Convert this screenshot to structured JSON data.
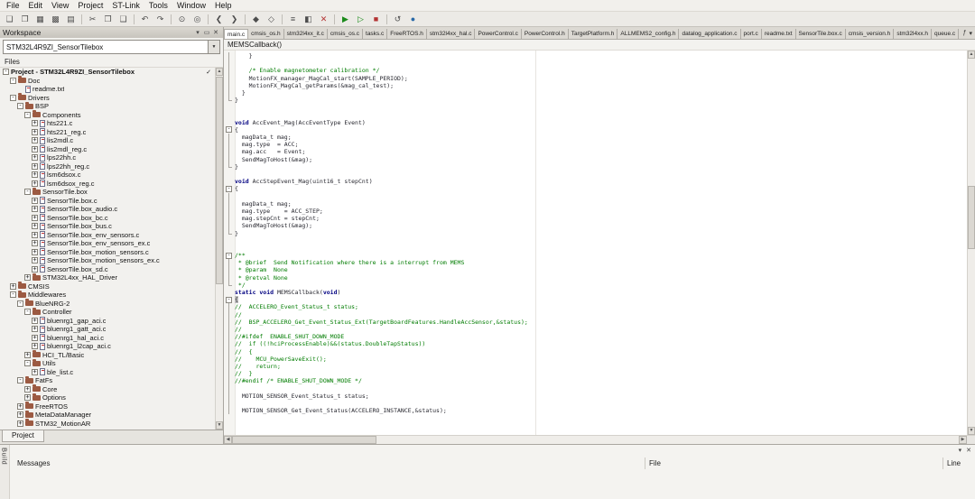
{
  "colors": {
    "comment": "#007c00",
    "keyword": "#000080",
    "plain_code": "#26262e",
    "chrome": "#e8e6e2",
    "editor_background": "#ffffff",
    "group_icon": "#9c5a42"
  },
  "menu": {
    "items": [
      "File",
      "Edit",
      "View",
      "Project",
      "ST-Link",
      "Tools",
      "Window",
      "Help"
    ]
  },
  "toolbar": {
    "buttons": [
      {
        "n": "new-document",
        "g": "❏"
      },
      {
        "n": "open-file",
        "g": "❐"
      },
      {
        "n": "save",
        "g": "▦"
      },
      {
        "n": "save-all",
        "g": "▩"
      },
      {
        "n": "print",
        "g": "▤"
      },
      {
        "sep": true
      },
      {
        "n": "cut",
        "g": "✂"
      },
      {
        "n": "copy",
        "g": "❒"
      },
      {
        "n": "paste",
        "g": "❑"
      },
      {
        "sep": true
      },
      {
        "n": "undo",
        "g": "↶"
      },
      {
        "n": "redo",
        "g": "↷"
      },
      {
        "sep": true
      },
      {
        "n": "find",
        "g": "⊙"
      },
      {
        "n": "find-next",
        "g": "◎"
      },
      {
        "sep": true
      },
      {
        "n": "navigate-back",
        "g": "❮"
      },
      {
        "n": "navigate-forward",
        "g": "❯"
      },
      {
        "sep": true
      },
      {
        "n": "toggle-bookmark",
        "g": "◆"
      },
      {
        "n": "next-bookmark",
        "g": "◇"
      },
      {
        "sep": true
      },
      {
        "n": "make",
        "g": "≡"
      },
      {
        "n": "compile",
        "g": "◧"
      },
      {
        "n": "stop-build",
        "g": "✕",
        "c": "#b33333"
      },
      {
        "sep": true
      },
      {
        "n": "download-and-debug",
        "g": "▶",
        "c": "#1a8a1a"
      },
      {
        "n": "debug-without-downloading",
        "g": "▷",
        "c": "#1a8a1a"
      },
      {
        "n": "stop-debug",
        "g": "■",
        "c": "#b33333"
      },
      {
        "sep": true
      },
      {
        "n": "reset",
        "g": "↺"
      },
      {
        "n": "st-link-utility",
        "g": "●",
        "c": "#2a6aa8"
      }
    ]
  },
  "workspace": {
    "title": "Workspace",
    "config": "STM32L4R9ZI_SensorTilebox",
    "files_header": "Files",
    "bottom_tab": "Project",
    "tree": [
      {
        "d": 0,
        "e": "-",
        "i": "",
        "t": "Project - STM32L4R9ZI_SensorTilebox",
        "bold": true,
        "check": true
      },
      {
        "d": 1,
        "e": "-",
        "i": "folder",
        "t": "Doc"
      },
      {
        "d": 2,
        "e": "",
        "i": "file",
        "t": "readme.txt"
      },
      {
        "d": 1,
        "e": "-",
        "i": "folder",
        "t": "Drivers"
      },
      {
        "d": 2,
        "e": "-",
        "i": "folder",
        "t": "BSP"
      },
      {
        "d": 3,
        "e": "-",
        "i": "folder",
        "t": "Components"
      },
      {
        "d": 4,
        "e": "+",
        "i": "file",
        "t": "hts221.c"
      },
      {
        "d": 4,
        "e": "+",
        "i": "file",
        "t": "hts221_reg.c"
      },
      {
        "d": 4,
        "e": "+",
        "i": "file",
        "t": "lis2mdl.c"
      },
      {
        "d": 4,
        "e": "+",
        "i": "file",
        "t": "lis2mdl_reg.c"
      },
      {
        "d": 4,
        "e": "+",
        "i": "file",
        "t": "lps22hh.c"
      },
      {
        "d": 4,
        "e": "+",
        "i": "file",
        "t": "lps22hh_reg.c"
      },
      {
        "d": 4,
        "e": "+",
        "i": "file",
        "t": "lsm6dsox.c"
      },
      {
        "d": 4,
        "e": "+",
        "i": "file",
        "t": "lsm6dsox_reg.c"
      },
      {
        "d": 3,
        "e": "-",
        "i": "folder",
        "t": "SensorTile.box"
      },
      {
        "d": 4,
        "e": "+",
        "i": "file",
        "t": "SensorTile.box.c"
      },
      {
        "d": 4,
        "e": "+",
        "i": "file",
        "t": "SensorTile.box_audio.c"
      },
      {
        "d": 4,
        "e": "+",
        "i": "file",
        "t": "SensorTile.box_bc.c"
      },
      {
        "d": 4,
        "e": "+",
        "i": "file",
        "t": "SensorTile.box_bus.c"
      },
      {
        "d": 4,
        "e": "+",
        "i": "file",
        "t": "SensorTile.box_env_sensors.c"
      },
      {
        "d": 4,
        "e": "+",
        "i": "file",
        "t": "SensorTile.box_env_sensors_ex.c"
      },
      {
        "d": 4,
        "e": "+",
        "i": "file",
        "t": "SensorTile.box_motion_sensors.c"
      },
      {
        "d": 4,
        "e": "+",
        "i": "file",
        "t": "SensorTile.box_motion_sensors_ex.c"
      },
      {
        "d": 4,
        "e": "+",
        "i": "file",
        "t": "SensorTile.box_sd.c"
      },
      {
        "d": 3,
        "e": "+",
        "i": "folder",
        "t": "STM32L4xx_HAL_Driver"
      },
      {
        "d": 1,
        "e": "+",
        "i": "folder",
        "t": "CMSIS"
      },
      {
        "d": 1,
        "e": "-",
        "i": "folder",
        "t": "Middlewares"
      },
      {
        "d": 2,
        "e": "-",
        "i": "folder",
        "t": "BlueNRG-2"
      },
      {
        "d": 3,
        "e": "-",
        "i": "folder",
        "t": "Controller"
      },
      {
        "d": 4,
        "e": "+",
        "i": "file",
        "t": "bluenrg1_gap_aci.c"
      },
      {
        "d": 4,
        "e": "+",
        "i": "file",
        "t": "bluenrg1_gatt_aci.c"
      },
      {
        "d": 4,
        "e": "+",
        "i": "file",
        "t": "bluenrg1_hal_aci.c"
      },
      {
        "d": 4,
        "e": "+",
        "i": "file",
        "t": "bluenrg1_l2cap_aci.c"
      },
      {
        "d": 3,
        "e": "+",
        "i": "folder",
        "t": "HCI_TL/Basic"
      },
      {
        "d": 3,
        "e": "-",
        "i": "folder",
        "t": "Utils"
      },
      {
        "d": 4,
        "e": "+",
        "i": "file",
        "t": "ble_list.c"
      },
      {
        "d": 2,
        "e": "-",
        "i": "folder",
        "t": "FatFs"
      },
      {
        "d": 3,
        "e": "+",
        "i": "folder",
        "t": "Core"
      },
      {
        "d": 3,
        "e": "+",
        "i": "folder",
        "t": "Options"
      },
      {
        "d": 2,
        "e": "+",
        "i": "folder",
        "t": "FreeRTOS"
      },
      {
        "d": 2,
        "e": "+",
        "i": "folder",
        "t": "MetaDataManager"
      },
      {
        "d": 2,
        "e": "+",
        "i": "folder",
        "t": "STM32_MotionAR"
      }
    ]
  },
  "editor": {
    "tabs": [
      {
        "label": "main.c",
        "active": true
      },
      {
        "label": "cmsis_os.h"
      },
      {
        "label": "stm32l4xx_it.c"
      },
      {
        "label": "cmsis_os.c"
      },
      {
        "label": "tasks.c"
      },
      {
        "label": "FreeRTOS.h"
      },
      {
        "label": "stm32l4xx_hal.c"
      },
      {
        "label": "PowerControl.c"
      },
      {
        "label": "PowerControl.h"
      },
      {
        "label": "TargetPlatform.h"
      },
      {
        "label": "ALLMEMS2_config.h"
      },
      {
        "label": "datalog_application.c"
      },
      {
        "label": "port.c"
      },
      {
        "label": "readme.txt"
      },
      {
        "label": "SensorTile.box.c"
      },
      {
        "label": "cmsis_version.h"
      },
      {
        "label": "stm32l4xx.h"
      },
      {
        "label": "queue.c"
      }
    ],
    "tab_tools": [
      "function-list-icon",
      "chevron-down-icon"
    ],
    "function_nav": "MEMSCallback()",
    "code": {
      "lines": [
        {
          "f": "l",
          "s": [
            [
              "p",
              "    }"
            ]
          ]
        },
        {
          "f": "l",
          "s": []
        },
        {
          "f": "l",
          "s": [
            [
              "c",
              "    /* Enable magnetometer calibration */"
            ]
          ]
        },
        {
          "f": "l",
          "s": [
            [
              "p",
              "    MotionFX_manager_MagCal_start(SAMPLE_PERIOD);"
            ]
          ]
        },
        {
          "f": "l",
          "s": [
            [
              "p",
              "    MotionFX_MagCal_getParams(&mag_cal_test);"
            ]
          ]
        },
        {
          "f": "l",
          "s": [
            [
              "p",
              "  }"
            ]
          ]
        },
        {
          "f": "e",
          "s": [
            [
              "p",
              "}"
            ]
          ]
        },
        {
          "f": "",
          "s": []
        },
        {
          "f": "",
          "s": []
        },
        {
          "f": "",
          "s": [
            [
              "k",
              "void"
            ],
            [
              "p",
              " AccEvent_Mag(AccEventType Event)"
            ]
          ]
        },
        {
          "f": "b",
          "s": [
            [
              "p",
              "{"
            ]
          ]
        },
        {
          "f": "l",
          "s": [
            [
              "p",
              "  magData_t mag;"
            ]
          ]
        },
        {
          "f": "l",
          "s": [
            [
              "p",
              "  mag.type  = ACC;"
            ]
          ]
        },
        {
          "f": "l",
          "s": [
            [
              "p",
              "  mag.acc   = Event;"
            ]
          ]
        },
        {
          "f": "l",
          "s": [
            [
              "p",
              "  SendMagToHost(&mag);"
            ]
          ]
        },
        {
          "f": "e",
          "s": [
            [
              "p",
              "}"
            ]
          ]
        },
        {
          "f": "",
          "s": []
        },
        {
          "f": "",
          "s": [
            [
              "k",
              "void"
            ],
            [
              "p",
              " AccStepEvent_Mag(uint16_t stepCnt)"
            ]
          ]
        },
        {
          "f": "b",
          "s": [
            [
              "p",
              "{"
            ]
          ]
        },
        {
          "f": "l",
          "s": []
        },
        {
          "f": "l",
          "s": [
            [
              "p",
              "  magData_t mag;"
            ]
          ]
        },
        {
          "f": "l",
          "s": [
            [
              "p",
              "  mag.type    = ACC_STEP;"
            ]
          ]
        },
        {
          "f": "l",
          "s": [
            [
              "p",
              "  mag.stepCnt = stepCnt;"
            ]
          ]
        },
        {
          "f": "l",
          "s": [
            [
              "p",
              "  SendMagToHost(&mag);"
            ]
          ]
        },
        {
          "f": "e",
          "s": [
            [
              "p",
              "}"
            ]
          ]
        },
        {
          "f": "",
          "s": []
        },
        {
          "f": "",
          "s": []
        },
        {
          "f": "b",
          "s": [
            [
              "c",
              "/**"
            ]
          ]
        },
        {
          "f": "l",
          "s": [
            [
              "c",
              " * @brief  Send Notification where there is a interrupt from MEMS"
            ]
          ]
        },
        {
          "f": "l",
          "s": [
            [
              "c",
              " * @param  None"
            ]
          ]
        },
        {
          "f": "l",
          "s": [
            [
              "c",
              " * @retval None"
            ]
          ]
        },
        {
          "f": "e",
          "s": [
            [
              "c",
              " */"
            ]
          ]
        },
        {
          "f": "",
          "s": [
            [
              "k",
              "static void"
            ],
            [
              "p",
              " MEMSCallback("
            ],
            [
              "k",
              "void"
            ],
            [
              "p",
              ")"
            ]
          ]
        },
        {
          "f": "b",
          "s": [
            [
              "h",
              "{"
            ]
          ]
        },
        {
          "f": "l",
          "s": [
            [
              "c",
              "//  ACCELERO_Event_Status_t status;"
            ]
          ]
        },
        {
          "f": "l",
          "s": [
            [
              "c",
              "//"
            ]
          ]
        },
        {
          "f": "l",
          "s": [
            [
              "c",
              "//  BSP_ACCELERO_Get_Event_Status_Ext(TargetBoardFeatures.HandleAccSensor,&status);"
            ]
          ]
        },
        {
          "f": "l",
          "s": [
            [
              "c",
              "//"
            ]
          ]
        },
        {
          "f": "l",
          "s": [
            [
              "c",
              "//#ifdef  ENABLE_SHUT_DOWN_MODE"
            ]
          ]
        },
        {
          "f": "l",
          "s": [
            [
              "c",
              "//  if ((!hciProcessEnable)&&(status.DoubleTapStatus))"
            ]
          ]
        },
        {
          "f": "l",
          "s": [
            [
              "c",
              "//  {"
            ]
          ]
        },
        {
          "f": "l",
          "s": [
            [
              "c",
              "//    MCU_PowerSaveExit();"
            ]
          ]
        },
        {
          "f": "l",
          "s": [
            [
              "c",
              "//    return;"
            ]
          ]
        },
        {
          "f": "l",
          "s": [
            [
              "c",
              "//  }"
            ]
          ]
        },
        {
          "f": "l",
          "s": [
            [
              "c",
              "//#endif /* ENABLE_SHUT_DOWN_MODE */"
            ]
          ]
        },
        {
          "f": "l",
          "s": []
        },
        {
          "f": "l",
          "s": [
            [
              "p",
              "  MOTION_SENSOR_Event_Status_t status;"
            ]
          ]
        },
        {
          "f": "l",
          "s": []
        },
        {
          "f": "l",
          "s": [
            [
              "p",
              "  MOTION_SENSOR_Get_Event_Status(ACCELERO_INSTANCE,&status);"
            ]
          ]
        }
      ]
    }
  },
  "build": {
    "tab": "Build",
    "columns": [
      "Messages",
      "File",
      "Line"
    ]
  }
}
